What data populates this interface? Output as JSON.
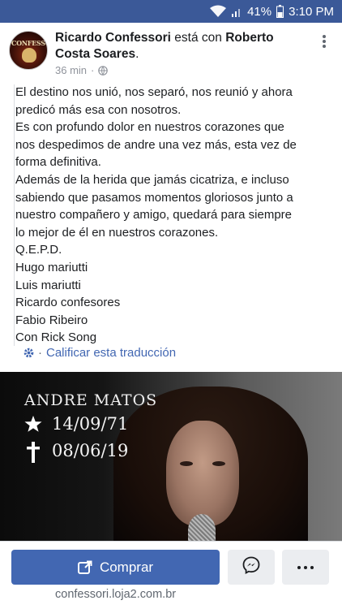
{
  "status_bar": {
    "battery_percent": "41%",
    "time": "3:10 PM",
    "icons": [
      "wifi-icon",
      "signal-icon",
      "battery-icon"
    ]
  },
  "post": {
    "author": "Ricardo Confessori",
    "with_text": "está con",
    "tagged": "Roberto Costa Soares",
    "tagged_suffix": ".",
    "time_ago": "36 min",
    "meta_separator": "·",
    "privacy_icon": "globe-icon",
    "avatar_text": "CONFESSORI",
    "body_lines": [
      "El destino nos unió, nos separó, nos reunió y ahora",
      "predicó más esa con nosotros.",
      "Es con profundo dolor en nuestros corazones que",
      "nos despedimos de andre una vez más, esta vez de",
      "forma definitiva.",
      "Además de la herida que jamás cicatriza, e incluso",
      "sabiendo que pasamos momentos gloriosos junto a",
      "nuestro compañero y amigo, quedará para siempre",
      "lo mejor de él en nuestros corazones.",
      "Q.E.P.D.",
      "Hugo mariutti",
      "Luis mariutti",
      "Ricardo confesores",
      "Fabio Ribeiro",
      "Con Rick Song"
    ],
    "translation_link": "Calificar esta traducción",
    "translation_separator": "·"
  },
  "image": {
    "title": "ANDRE MATOS",
    "birth_date": "14/09/71",
    "death_date": "08/06/19"
  },
  "actions": {
    "buy_label": "Comprar",
    "site_link": "confessori.loja2.com.br"
  },
  "colors": {
    "status_bar": "#3b5998",
    "accent": "#4267b2",
    "text": "#1c1e21",
    "meta": "#90949c"
  }
}
